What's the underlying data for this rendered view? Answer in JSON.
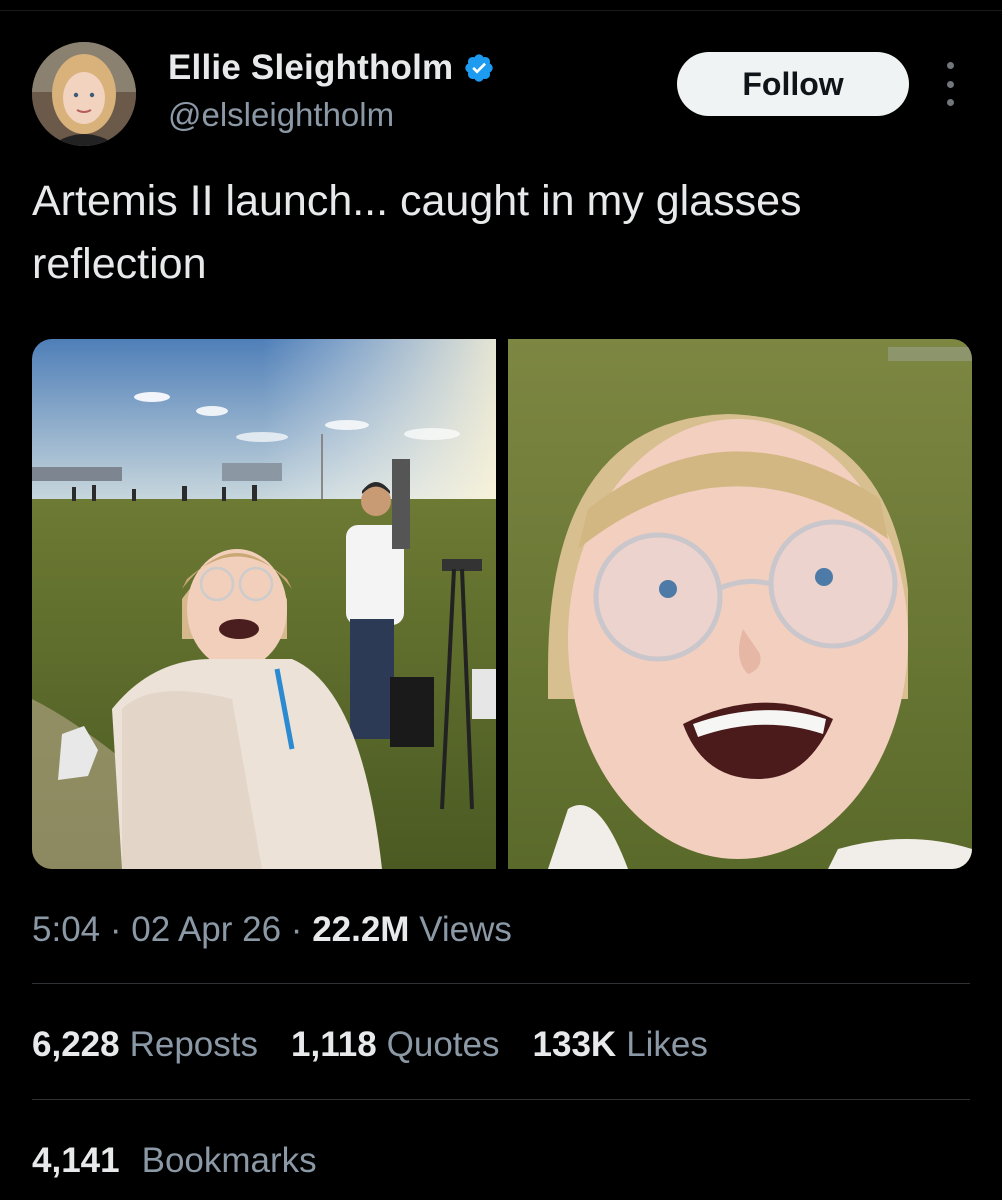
{
  "author": {
    "display_name": "Ellie Sleightholm",
    "handle": "@elsleightholm",
    "verified": true
  },
  "follow_button_label": "Follow",
  "tweet": {
    "text": "Artemis II launch... caught in my glasses\nreflection"
  },
  "meta": {
    "time": "5:04",
    "separator": " · ",
    "date": "02 Apr 26",
    "views_count": "22.2M",
    "views_label": " Views"
  },
  "stats": {
    "reposts": {
      "count": "6,228",
      "label": "Reposts"
    },
    "quotes": {
      "count": "1,118",
      "label": "Quotes"
    },
    "likes": {
      "count": "133K",
      "label": "Likes"
    }
  },
  "bookmarks": {
    "count": "4,141",
    "label": "Bookmarks"
  },
  "colors": {
    "background": "#000000",
    "text_primary": "#e7e9ea",
    "text_secondary": "#8b98a5",
    "verified_blue": "#1d9bf0",
    "divider": "#2f3336",
    "follow_bg": "#eff3f4"
  },
  "icons": {
    "verified": "verified-badge-icon",
    "more": "more-options-icon"
  }
}
